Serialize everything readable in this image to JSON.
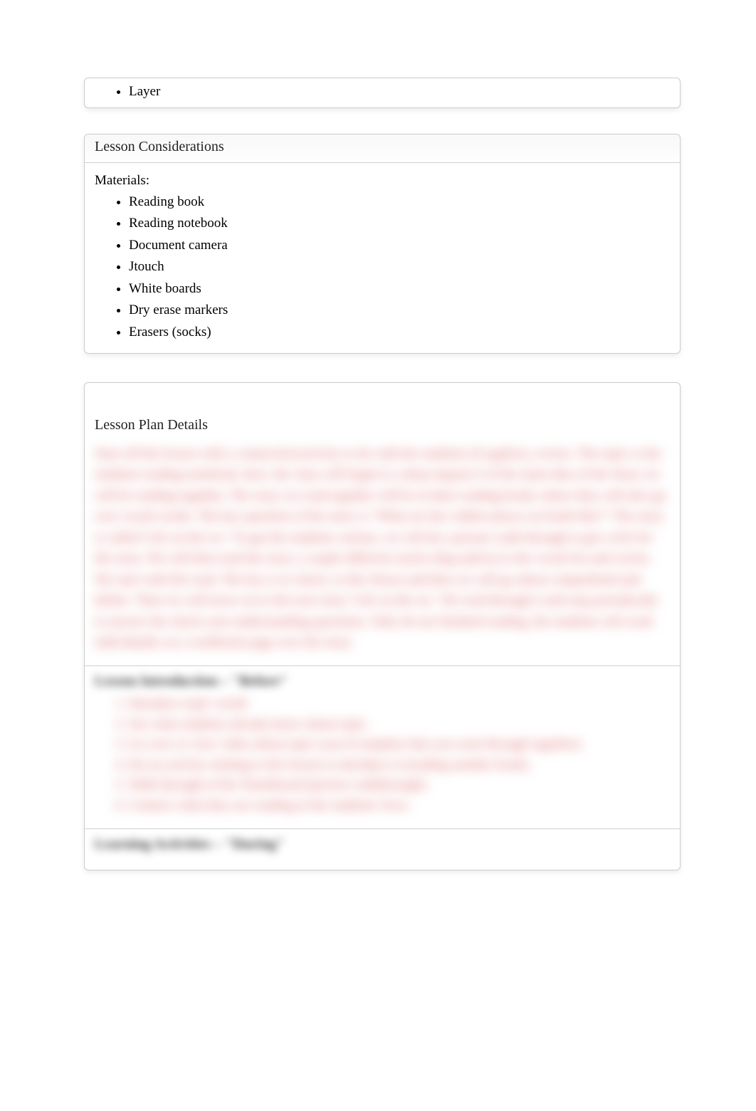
{
  "top_item": "Layer",
  "considerations": {
    "heading": "Lesson Considerations",
    "materials_label": "Materials:",
    "materials": [
      "Reading book",
      "Reading notebook",
      "Document camera",
      "Jtouch",
      "White boards",
      "Dry erase markers",
      "Erasers (socks)"
    ]
  },
  "details": {
    "heading": "Lesson Plan Details",
    "intro_paragraph": "Start off the lesson with a connection/activity to do with the students (if applies), review. The topic is the students reading notebook, here, the class will begin to a deep inquiry/3 of the main idea of the Story we will be reading together. The story we read together will be in their reading books where they will also go over vocab words. The key question of the story is \"What are the coldest places on Earth like?\" The story is called 'Life on the ice.' To get the students curious, we will do a picture walk through to get a feel for the story. We will then read the story a couple different stories (big and/or) to the vocab list and circles. We start with life read. The key is to check, to this Story) and then we will go about comprehend and define. Then we will move on to the next story 'Life on the ice.' We read through it and stop periodically to answer the check your understanding questions. Only do not finished reading, the students will work individually on a workbook page over the story.",
    "intro_heading": "Lesson Introduction – \"Before\"",
    "intro_steps": [
      "Introduce topic words",
      "See what students already know about topic.",
      "Go over or view video about topic (can it/complete that you went through together).",
      "Do an activity relating to the lesson to introduce it (reading another book).",
      "Walk through of the Smartboard (picture walkthrough).",
      "Connect what they are reading in the students' lives."
    ],
    "activities_heading": "Learning Activities – \"During\""
  }
}
